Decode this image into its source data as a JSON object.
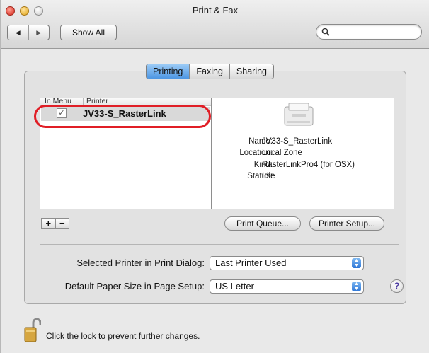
{
  "window": {
    "title": "Print & Fax",
    "show_all": "Show All",
    "search_placeholder": ""
  },
  "tabs": [
    "Printing",
    "Faxing",
    "Sharing"
  ],
  "list": {
    "col_in_menu": "In Menu",
    "col_printer": "Printer",
    "printers": [
      {
        "name": "JV33-S_RasterLink",
        "in_menu": true,
        "selected": true
      }
    ]
  },
  "details": {
    "name_label": "Name:",
    "name_value": "JV33-S_RasterLink",
    "location_label": "Location:",
    "location_value": "Local Zone",
    "kind_label": "Kind:",
    "kind_value": "RasterLinkPro4 (for OSX)",
    "status_label": "Status:",
    "status_value": "Idle"
  },
  "buttons": {
    "add": "+",
    "remove": "−",
    "print_queue": "Print Queue...",
    "printer_setup": "Printer Setup..."
  },
  "selected_printer": {
    "label": "Selected Printer in Print Dialog:",
    "value": "Last Printer Used"
  },
  "paper_size": {
    "label": "Default Paper Size in Page Setup:",
    "value": "US Letter"
  },
  "help": "?",
  "lock_text": "Click the lock to prevent further changes.",
  "colors": {
    "highlight": "#e01e26",
    "tab_active": "#4d96e3"
  }
}
